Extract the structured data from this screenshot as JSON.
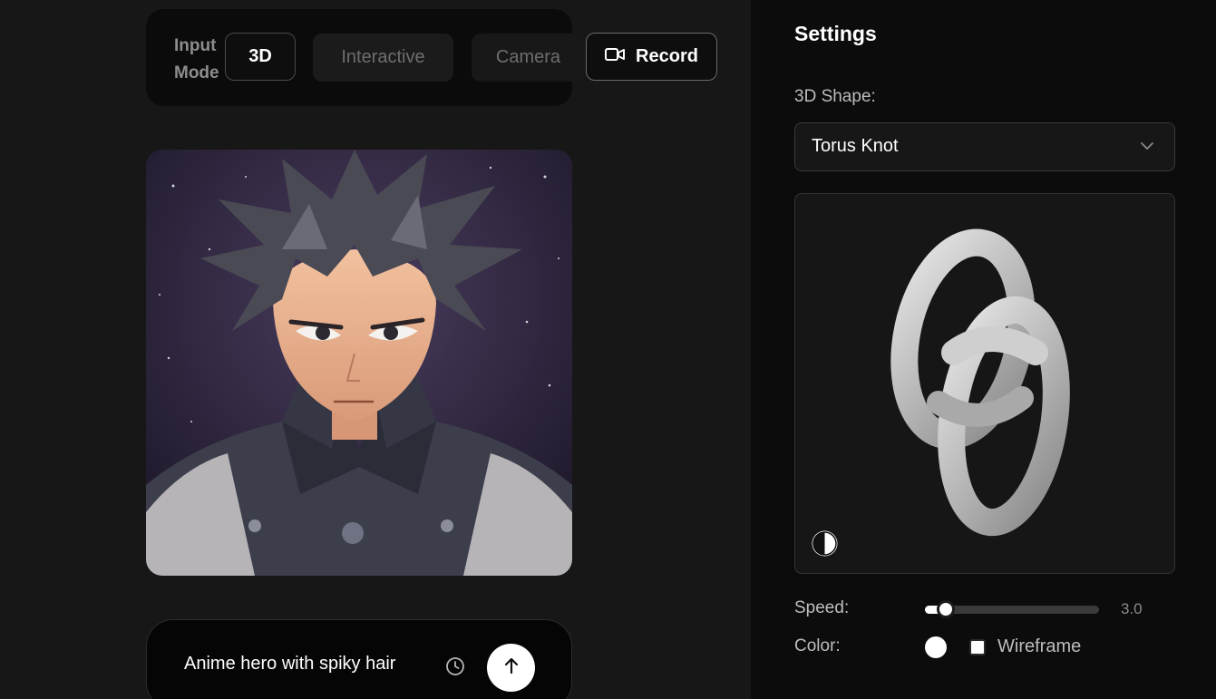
{
  "input_mode": {
    "label": "Input Mode",
    "buttons": [
      {
        "label": "3D",
        "active": true
      },
      {
        "label": "Interactive",
        "active": false
      },
      {
        "label": "Camera",
        "active": false
      }
    ],
    "record_label": "Record"
  },
  "prompt": {
    "text": "Anime hero with spiky hair"
  },
  "settings": {
    "title": "Settings",
    "shape_label": "3D Shape:",
    "shape_value": "Torus Knot",
    "speed_label": "Speed:",
    "speed_value": "3.0",
    "speed_fraction": 0.12,
    "color_label": "Color:",
    "color_value": "#ffffff",
    "wireframe_label": "Wireframe",
    "wireframe_checked": false
  },
  "icons": {
    "record": "video-camera-icon",
    "history": "clock-icon",
    "send": "arrow-up-icon",
    "dropdown": "chevron-down-icon",
    "theme": "contrast-icon"
  }
}
